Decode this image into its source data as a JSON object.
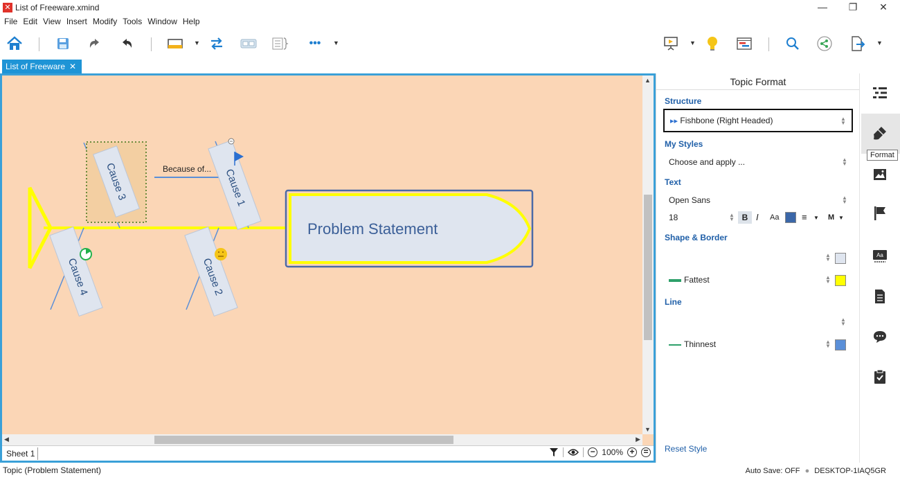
{
  "window": {
    "title": "List of Freeware.xmind",
    "minimize": "—",
    "restore": "❐",
    "close": "✕"
  },
  "menu": [
    "File",
    "Edit",
    "View",
    "Insert",
    "Modify",
    "Tools",
    "Window",
    "Help"
  ],
  "toolbar": {
    "home": "home-icon",
    "save": "save-icon",
    "undo": "undo-icon",
    "redo": "redo-icon",
    "more": "•••"
  },
  "tab": {
    "label": "List of Freeware",
    "close": "✕"
  },
  "canvas": {
    "background": "#fbd6b6",
    "central_topic": "Problem Statement",
    "topics": [
      "Cause 1",
      "Cause 2",
      "Cause 3",
      "Cause 4"
    ],
    "relationship_label": "Because of..."
  },
  "sheetbar": {
    "sheet": "Sheet 1",
    "zoom": "100%"
  },
  "panel": {
    "title": "Topic Format",
    "structure_title": "Structure",
    "structure_value": "Fishbone (Right Headed)",
    "mystyles_title": "My Styles",
    "mystyles_value": "Choose and apply ...",
    "text_title": "Text",
    "font_family": "Open Sans",
    "font_size": "18",
    "bold": "B",
    "italic": "I",
    "case": "Aa",
    "align": "≡",
    "size_m": "M",
    "shape_title": "Shape & Border",
    "border_width": "Fattest",
    "line_title": "Line",
    "line_width": "Thinnest",
    "reset": "Reset Style",
    "colors": {
      "text": "#3b67a8",
      "fill": "#dfe5ef",
      "border": "#ffff00",
      "line": "#5a8fd8",
      "border_line": "#2ea06a",
      "line_stroke": "#2ea06a"
    }
  },
  "rail": {
    "tooltip": "Format"
  },
  "status": {
    "left": "Topic (Problem Statement)",
    "autosave": "Auto Save: OFF",
    "computer": "DESKTOP-1IAQ5GR"
  }
}
